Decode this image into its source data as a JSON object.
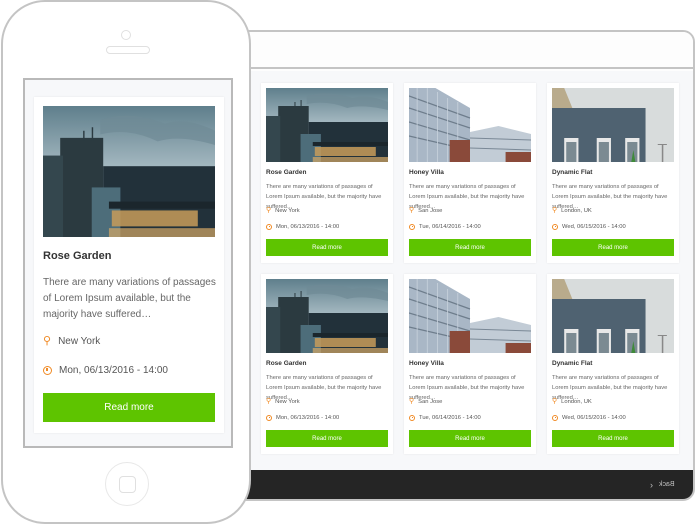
{
  "phone": {
    "card": {
      "title": "Rose Garden",
      "description": "There are many variations of passages of Lorem Ipsum available, but the majority have suffered…",
      "location": "New York",
      "date": "Mon, 06/13/2016 - 14:00",
      "button_label": "Read more",
      "image": "office-building-dusk"
    }
  },
  "desktop": {
    "cards": [
      {
        "title": "Rose Garden",
        "description": "There are many variations of passages of Lorem Ipsum available, but the majority have suffered…",
        "location": "New York",
        "date": "Mon, 06/13/2016 - 14:00",
        "button_label": "Read more",
        "image": "office-building-dusk"
      },
      {
        "title": "Honey Villa",
        "description": "There are many variations of passages of Lorem Ipsum available, but the majority have suffered…",
        "location": "San Jose",
        "date": "Tue, 06/14/2016 - 14:00",
        "button_label": "Read more",
        "image": "glass-building"
      },
      {
        "title": "Dynamic Flat",
        "description": "There are many variations of passages of Lorem Ipsum available, but the majority have suffered…",
        "location": "London, UK",
        "date": "Wed, 06/15/2016 - 14:00",
        "button_label": "Read more",
        "image": "blue-brick-house"
      },
      {
        "title": "Rose Garden",
        "description": "There are many variations of passages of Lorem Ipsum available, but the majority have suffered…",
        "location": "New York",
        "date": "Mon, 06/13/2016 - 14:00",
        "button_label": "Read more",
        "image": "office-building-dusk"
      },
      {
        "title": "Honey Villa",
        "description": "There are many variations of passages of Lorem Ipsum available, but the majority have suffered…",
        "location": "San Jose",
        "date": "Tue, 06/14/2016 - 14:00",
        "button_label": "Read more",
        "image": "glass-building"
      },
      {
        "title": "Dynamic Flat",
        "description": "There are many variations of passages of Lorem Ipsum available, but the majority have suffered…",
        "location": "London, UK",
        "date": "Wed, 06/15/2016 - 14:00",
        "button_label": "Read more",
        "image": "blue-brick-house"
      }
    ],
    "footer": {
      "back_label": "Back",
      "back_icon": "chevron-left-icon"
    }
  },
  "icons": {
    "location": "map-pin-icon",
    "date": "clock-icon"
  },
  "colors": {
    "accent_green": "#5ec400",
    "icon_orange": "#f08a24",
    "footer_dark": "#252525"
  }
}
